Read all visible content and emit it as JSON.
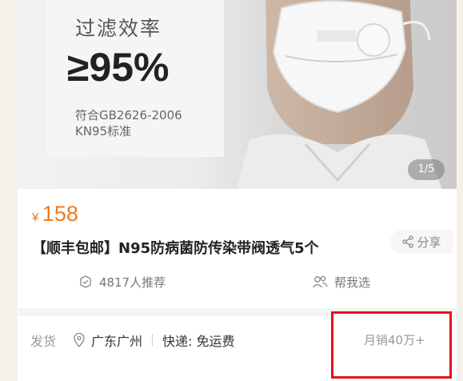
{
  "hero": {
    "title": "过滤效率",
    "big_value": "≥95%",
    "standard_line1": "符合GB2626-2006",
    "standard_line2": "KN95标准",
    "image_counter": "1/5"
  },
  "product": {
    "currency": "¥",
    "price": "158",
    "title": "【顺丰包邮】N95防病菌防传染带阀透气5个",
    "share_label": "分享"
  },
  "social": {
    "recommend_label": "4817人推荐",
    "help_choose_label": "帮我选"
  },
  "shipping": {
    "label": "发货",
    "location": "广东广州",
    "express": "快递: 免运费",
    "monthly_sales": "月销40万+"
  },
  "colors": {
    "price": "#f07a1e",
    "highlight_box": "#e8101a"
  }
}
